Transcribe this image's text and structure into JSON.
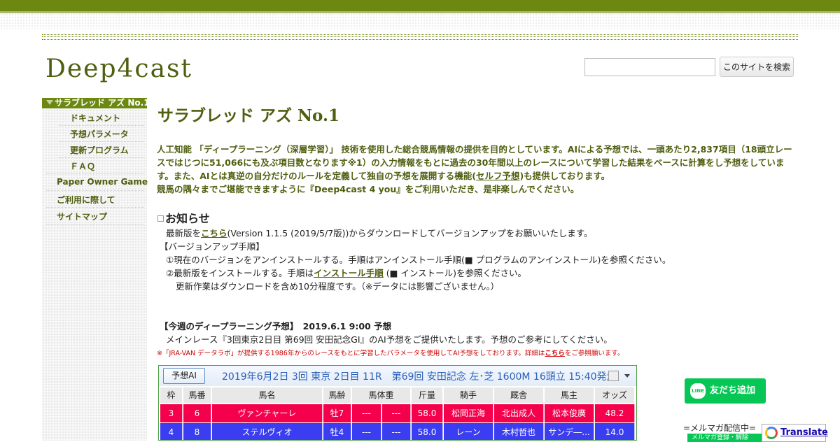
{
  "site": {
    "title": "Deep4cast"
  },
  "search": {
    "placeholder": "",
    "button": "このサイトを検索"
  },
  "sidebar": {
    "items": [
      {
        "label": "サラブレッド アズ No.1"
      },
      {
        "label": "ドキュメント"
      },
      {
        "label": "予想パラメータ"
      },
      {
        "label": "更新プログラム"
      },
      {
        "label": "ＦＡＱ"
      },
      {
        "label": "Paper Owner Game"
      },
      {
        "label": "ご利用に際して"
      },
      {
        "label": "サイトマップ"
      }
    ]
  },
  "main": {
    "title": "サラブレッド アズ No.1",
    "intro_1": "人工知能 「ディープラーニング（深層学習）」 技術を使用した総合競馬情報の提供を目的としています。AIによる予想では、一頭あたり2,837項目（18頭立レースではじつに51,066にも及ぶ項目数となります※1）の入力情報をもとに過去の30年間以上のレースについて学習した結果をベースに計算をし予想をしています。また、AIとは真逆の自分だけのルールを定義して独自の予想を展開する機能(",
    "intro_link": "セルフ予想",
    "intro_2": ")も提供しております。",
    "intro_3": "競馬の隅々までご堪能できますように『Deep4cast 4 you』をご利用いただき、是非楽しんでください。",
    "news_heading": "お知らせ",
    "news_1a": "最新版を",
    "news_1link": "こちら",
    "news_1b": "(Version 1.1.5 (2019/5/7版))からダウンロードしてバージョンアップをお願いいたします。",
    "news_2": "【バージョンアップ手順】",
    "news_3": "①現在のバージョンをアンインストールする。手順はアンインストール手順(■ プログラムのアンインストール)を参照ください。",
    "news_4a": "②最新版をインストールする。手順は",
    "news_4link": "インストール手順",
    "news_4b": " (■ インストール)を参照ください。",
    "news_5": "更新作業はダウンロードを含め10分程度です。（※データには影響ございません。）",
    "weekly_heading": "【今週のディープラーニング予想】　2019.6.1 9:00 予想",
    "weekly_text": "メインレース『3回東京2日目 第69回 安田記念GI』のAI予想をご提供いたします。予想のご参考にしてください。",
    "note_a": "※「JRA-VAN データラボ」が提供する1986年からのレースをもとに学習したパラメータを使用してAI予想をしております。詳細は",
    "note_link": "こちら",
    "note_b": "をご参照願います。"
  },
  "race_table": {
    "ai_button": "予想AI",
    "info": "2019年6月2日 3回 東京 2日目 11R　第69回 安田記念  左･芝 1600M  16頭立  15:40発走",
    "columns": [
      "枠",
      "馬番",
      "馬名",
      "馬齢",
      "馬体重",
      "斤量",
      "騎手",
      "厩舎",
      "馬主",
      "オッズ"
    ],
    "rows": [
      {
        "waku": "3",
        "umaban": "6",
        "name": "ヴァンチャーレ",
        "age": "牡7",
        "weight": "---",
        "weight_diff": "---",
        "kinryo": "58.0",
        "jockey": "松岡正海",
        "stable": "北出成人",
        "owner": "松本俊廣",
        "odds": "48.2",
        "color": "#f5004d"
      },
      {
        "waku": "4",
        "umaban": "8",
        "name": "ステルヴィオ",
        "age": "牡4",
        "weight": "---",
        "weight_diff": "---",
        "kinryo": "58.0",
        "jockey": "レーン",
        "stable": "木村哲也",
        "owner": "サンデ―...",
        "odds": "14.0",
        "color": "#3a3ef0"
      }
    ]
  },
  "line": {
    "button": "友だち追加",
    "icon": "LINE"
  },
  "mail": {
    "text": "=メルマガ配信中=",
    "button": "メルマガ登録・解除"
  },
  "translate": {
    "label": "Translate"
  },
  "colors": {
    "brand": "#6d8811",
    "text_green": "#4f5f10",
    "note_red": "#d10000"
  }
}
